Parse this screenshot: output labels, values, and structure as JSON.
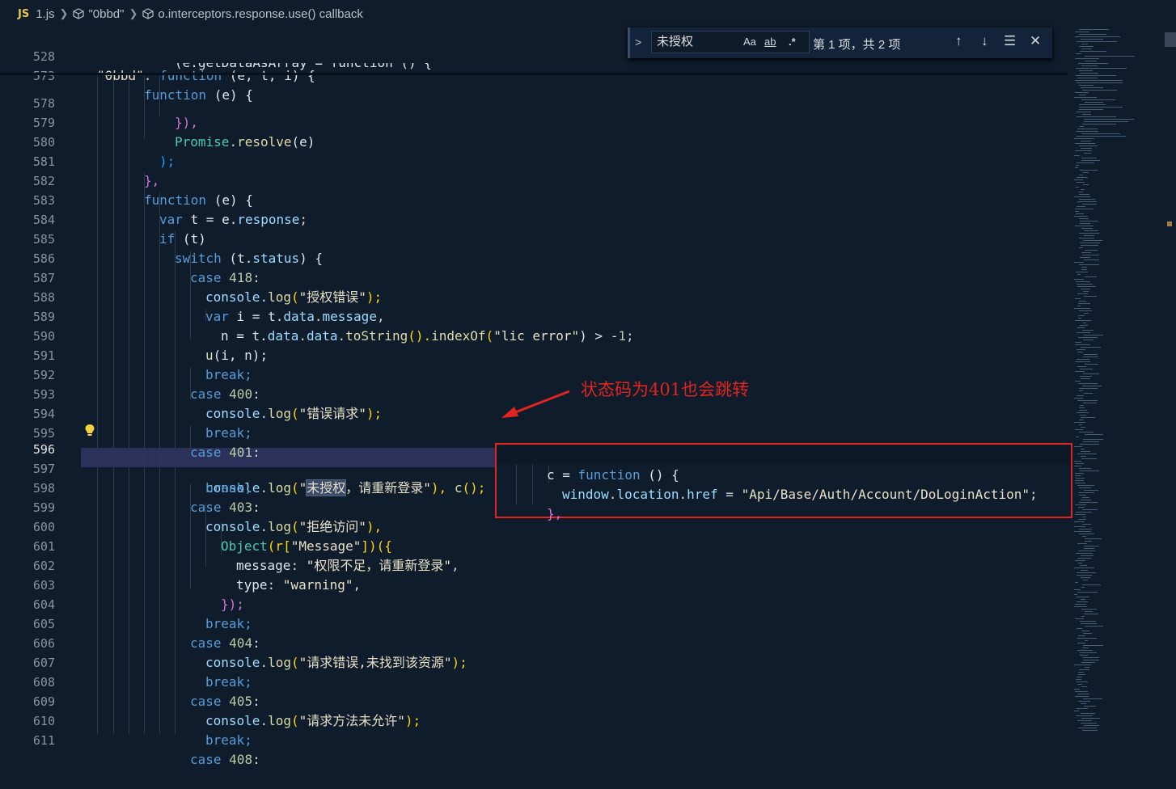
{
  "breadcrumb": {
    "badge": "JS",
    "file": "1.js",
    "module": "\"0bbd\"",
    "callback": "o.interceptors.response.use() callback"
  },
  "find_widget": {
    "toggle": ">",
    "query": "未授权",
    "match_case": "Aa",
    "whole_word": "ab",
    "regex": ".*",
    "result": "第 1 项，共 2 项",
    "prev": "↑",
    "next": "↓",
    "selection": "☰",
    "close": "✕"
  },
  "annotation": {
    "text": "状态码为401也会跳转",
    "color": "#e0241f"
  },
  "lines": [
    {
      "n": "528"
    },
    {
      "n": "573"
    },
    {
      "n": "578"
    },
    {
      "n": "579"
    },
    {
      "n": "580"
    },
    {
      "n": "581"
    },
    {
      "n": "582"
    },
    {
      "n": "583"
    },
    {
      "n": "584"
    },
    {
      "n": "585"
    },
    {
      "n": "586"
    },
    {
      "n": "587"
    },
    {
      "n": "588"
    },
    {
      "n": "589"
    },
    {
      "n": "590"
    },
    {
      "n": "591"
    },
    {
      "n": "592"
    },
    {
      "n": "593"
    },
    {
      "n": "594"
    },
    {
      "n": "595"
    },
    {
      "n": "596"
    },
    {
      "n": "597"
    },
    {
      "n": "598"
    },
    {
      "n": "599"
    },
    {
      "n": "600"
    },
    {
      "n": "601"
    },
    {
      "n": "602"
    },
    {
      "n": "603"
    },
    {
      "n": "604"
    },
    {
      "n": "605"
    },
    {
      "n": "606"
    },
    {
      "n": "607"
    },
    {
      "n": "608"
    },
    {
      "n": "609"
    },
    {
      "n": "610"
    },
    {
      "n": "611"
    }
  ],
  "code": {
    "l528": [
      "\"0bbd\"",
      ": ",
      "function",
      " (e, t, i) {"
    ],
    "l573": [
      "function",
      " (e) {"
    ],
    "l573b": "(e.getDataAsArray = function () {",
    "l578": "}),",
    "l579": [
      "Promise",
      ".",
      "resolve",
      "(e)"
    ],
    "l580": ");",
    "l581": "},",
    "l582": [
      "function",
      " (e) {"
    ],
    "l583": [
      "var",
      " t = e.",
      "response",
      ";"
    ],
    "l584": [
      "if",
      " (t)"
    ],
    "l585": [
      "switch",
      " (t.",
      "status",
      ") {"
    ],
    "l586": [
      "case",
      " ",
      "418",
      ":"
    ],
    "l587": [
      "console",
      ".",
      "log",
      "(",
      "\"授权错误\"",
      ");"
    ],
    "l588": [
      "var",
      " i = t.",
      "data",
      ".",
      "message",
      ","
    ],
    "l589": [
      "n = t.",
      "data",
      ".",
      "data",
      ".",
      "toString",
      "().",
      "indexOf",
      "(",
      "\"lic error\"",
      ") > -",
      "1",
      ";"
    ],
    "l590": [
      "u",
      "(i, n);"
    ],
    "l591": "break;",
    "l592": [
      "case",
      " ",
      "400",
      ":"
    ],
    "l593": [
      "console",
      ".",
      "log",
      "(",
      "\"错误请求\"",
      ");"
    ],
    "l594": "break;",
    "l595": [
      "case",
      " ",
      "401",
      ":"
    ],
    "l596": [
      "console",
      ".",
      "log",
      "(",
      "\"",
      "未授权",
      "，请重新登录\"",
      "), ",
      "c",
      "();"
    ],
    "l597": "break;",
    "l598": [
      "case",
      " ",
      "403",
      ":"
    ],
    "l599": [
      "console",
      ".",
      "log",
      "(",
      "\"拒绝访问\"",
      "),"
    ],
    "l600": [
      "Object",
      "(r[",
      "\"Message\"",
      "])({"
    ],
    "l601": [
      "message",
      ": ",
      "\"权限不足，请重新登录\"",
      ","
    ],
    "l602": [
      "type",
      ": ",
      "\"warning\"",
      ","
    ],
    "l603": "});",
    "l604": "break;",
    "l605": [
      "case",
      " ",
      "404",
      ":"
    ],
    "l606": [
      "console",
      ".",
      "log",
      "(",
      "\"请求错误,未找到该资源\"",
      ");"
    ],
    "l607": "break;",
    "l608": [
      "case",
      " ",
      "405",
      ":"
    ],
    "l609": [
      "console",
      ".",
      "log",
      "(",
      "\"请求方法未允许\"",
      ");"
    ],
    "l610": "break;",
    "l611": [
      "case",
      " ",
      "408",
      ":"
    ]
  },
  "popup": {
    "l1": [
      "c = ",
      "function",
      " () {"
    ],
    "l2": [
      "window",
      ".",
      "location",
      ".",
      "href",
      " = ",
      "\"Api/Base/Auth/Account/DoLoginAction\"",
      ";"
    ],
    "l3": "},"
  }
}
